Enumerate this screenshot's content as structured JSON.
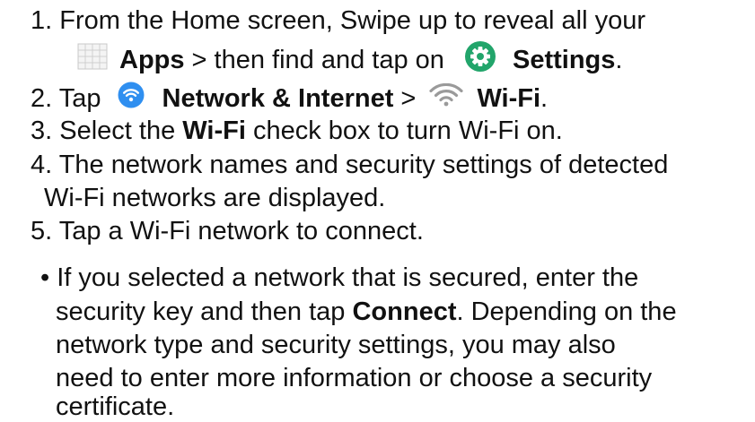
{
  "steps": {
    "s1": {
      "line1": "1. From the Home screen, Swipe up to reveal all your",
      "apps_label": "Apps",
      "mid": " > then find and tap on ",
      "settings_label": "Settings",
      "end": "."
    },
    "s2": {
      "prefix": "2. Tap ",
      "network_label": "Network & Internet",
      "sep": " > ",
      "wifi_label": "Wi-Fi",
      "end": "."
    },
    "s3": {
      "prefix": "3. Select the ",
      "wifi_label": "Wi-Fi",
      "rest": " check box to turn Wi-Fi on."
    },
    "s4": {
      "line1": "4. The network names and security settings of detected",
      "line2": "Wi-Fi networks are displayed."
    },
    "s5": {
      "line1": "5. Tap a Wi-Fi network to connect."
    }
  },
  "bullet": {
    "line1": "• If you selected a network that is secured, enter the",
    "line2_prefix": "security key and then tap ",
    "connect_label": "Connect",
    "line2_rest": ". Depending on the",
    "line3": "network type and security settings, you may also",
    "line4": "need to enter more information or choose a security",
    "line5": "certificate."
  },
  "icons": {
    "apps": "apps-grid-icon",
    "settings": "settings-gear-icon",
    "network": "wifi-circle-icon",
    "wifi": "wifi-icon"
  },
  "colors": {
    "settings_green": "#22a56b",
    "network_blue": "#2f8ff0",
    "wifi_grey": "#9a9a9a"
  }
}
